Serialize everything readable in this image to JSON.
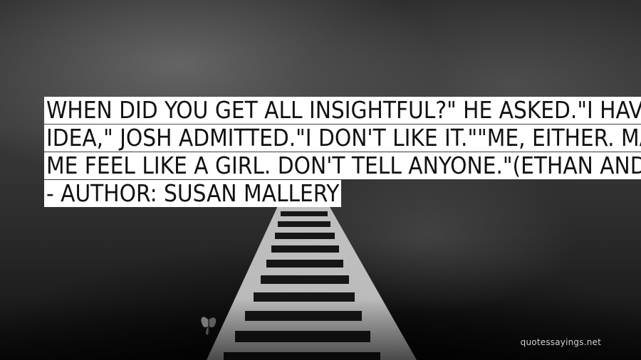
{
  "quote": {
    "lines": [
      "WHEN DID YOU GET ALL INSIGHTFUL?\" HE ASKED.\"I HAVE NO",
      "IDEA,\" JOSH ADMITTED.\"I DON'T LIKE IT.\"\"ME, EITHER. MAKES",
      "ME FEEL LIKE A GIRL. DON'T TELL ANYONE.\"(ETHAN AND JOSH)"
    ],
    "author_line": "- AUTHOR: SUSAN MALLERY"
  },
  "watermark": "quotessayings.net",
  "icons": {
    "butterfly": "butterfly-icon"
  },
  "colors": {
    "label_background": "#ffffff",
    "label_text": "#111111"
  }
}
